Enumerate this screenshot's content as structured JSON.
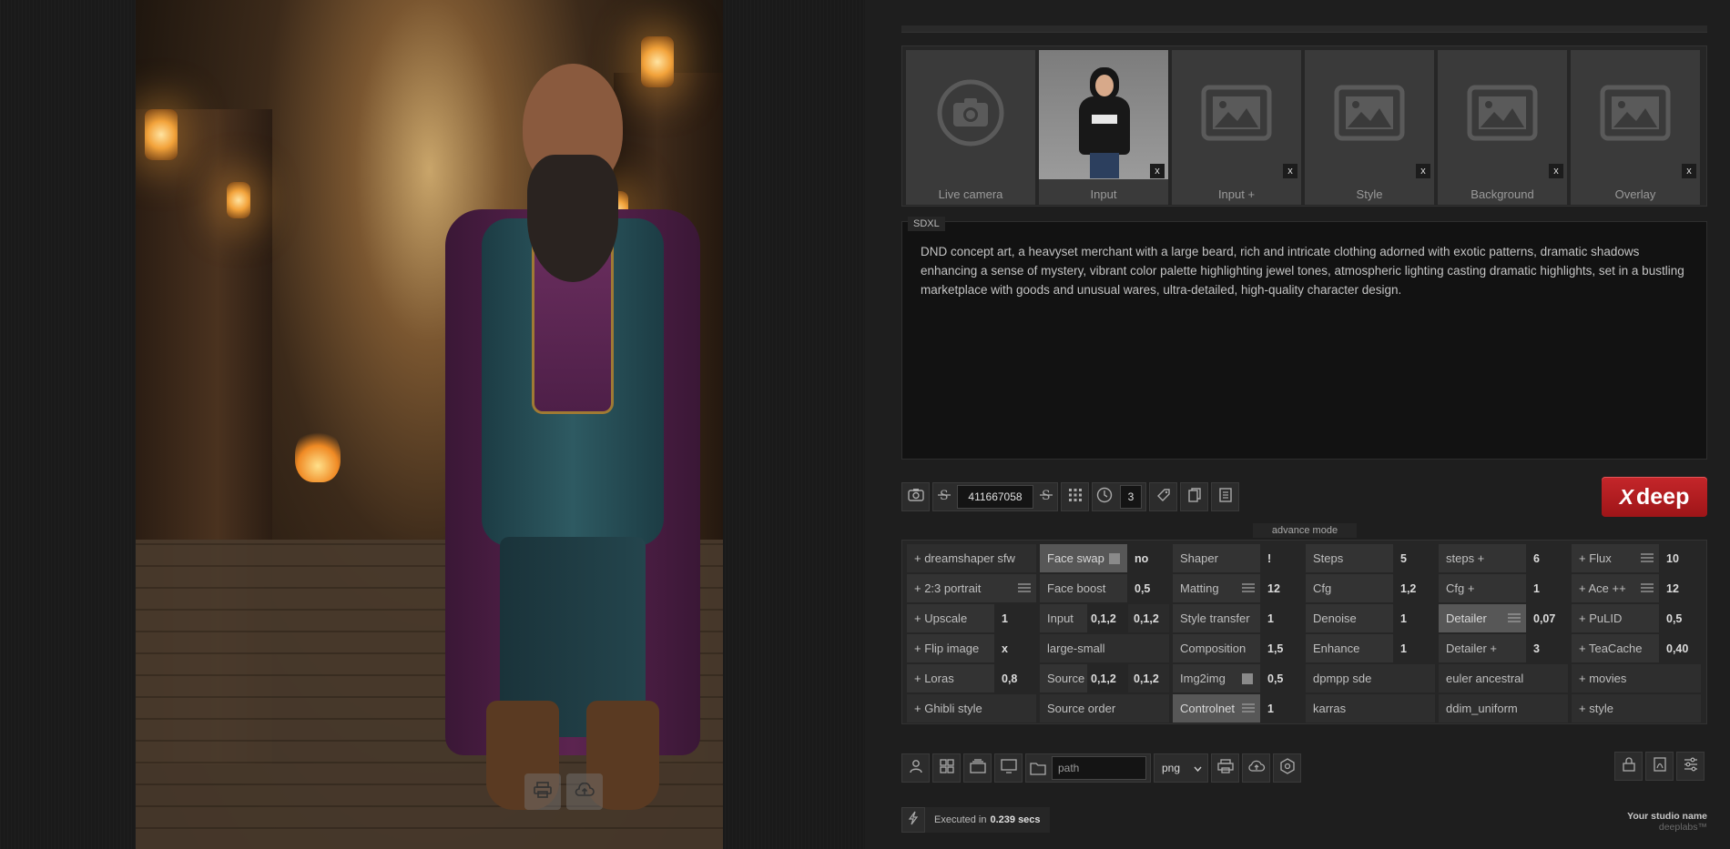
{
  "preview": {
    "tools": [
      {
        "icon": "printer-icon"
      },
      {
        "icon": "cloud-upload-icon"
      }
    ]
  },
  "slots": [
    {
      "label": "Live camera",
      "icon": "camera-icon",
      "has_close": false
    },
    {
      "label": "Input",
      "icon": "input-photo",
      "has_close": true
    },
    {
      "label": "Input +",
      "icon": "image-placeholder-icon",
      "has_close": true
    },
    {
      "label": "Style",
      "icon": "image-placeholder-icon",
      "has_close": true
    },
    {
      "label": "Background",
      "icon": "image-placeholder-icon",
      "has_close": true
    },
    {
      "label": "Overlay",
      "icon": "image-placeholder-icon",
      "has_close": true
    }
  ],
  "slot_close_label": "x",
  "prompt": {
    "model": "SDXL",
    "text": "DND concept art, a heavyset merchant with a large beard, rich and intricate clothing adorned with exotic patterns, dramatic shadows enhancing a sense of mystery, vibrant color palette highlighting jewel tones, atmospheric lighting casting dramatic highlights, set in a bustling marketplace with goods and unusual wares, ultra-detailed, high-quality character design."
  },
  "toolbar": {
    "seed": "411667058",
    "batch": "3"
  },
  "generate": {
    "label": "deep",
    "mark": "X",
    "color": "#b81d21"
  },
  "advance_label": "advance mode",
  "grid": {
    "columns": [
      [
        {
          "label": "+ dreamshaper sfw",
          "full": true
        },
        {
          "label": "+ 2:3 portrait",
          "menu": true
        },
        {
          "label": "+ Upscale",
          "value": "1"
        },
        {
          "label": "+ Flip image",
          "value": "x"
        },
        {
          "label": "+ Loras",
          "value": "0,8"
        },
        {
          "label": "+ Ghibli style",
          "full": true
        }
      ],
      [
        {
          "label": "Face swap",
          "highlight": true,
          "checkbox": true,
          "value": "no"
        },
        {
          "label": "Face boost",
          "value": "0,5"
        },
        {
          "label": "Input",
          "value": "0,1,2",
          "value2": "0,1,2"
        },
        {
          "label": "large-small",
          "full": true
        },
        {
          "label": "Source",
          "value": "0,1,2",
          "value2": "0,1,2"
        },
        {
          "label": "Source order",
          "full": true
        }
      ],
      [
        {
          "label": "Shaper",
          "value": "!"
        },
        {
          "label": "Matting",
          "menu": true,
          "value": "12"
        },
        {
          "label": "Style transfer",
          "value": "1"
        },
        {
          "label": "Composition",
          "value": "1,5"
        },
        {
          "label": "Img2img",
          "checkbox": true,
          "value": "0,5"
        },
        {
          "label": "Controlnet",
          "highlight": true,
          "menu": true,
          "value": "1"
        }
      ],
      [
        {
          "label": "Steps",
          "value": "5"
        },
        {
          "label": "Cfg",
          "value": "1,2"
        },
        {
          "label": "Denoise",
          "value": "1"
        },
        {
          "label": "Enhance",
          "value": "1"
        },
        {
          "label": "dpmpp sde",
          "full": true
        },
        {
          "label": "karras",
          "full": true
        }
      ],
      [
        {
          "label": "steps +",
          "value": "6"
        },
        {
          "label": "Cfg +",
          "value": "1"
        },
        {
          "label": "Detailer",
          "highlight": true,
          "menu": true,
          "value": "0,07"
        },
        {
          "label": "Detailer +",
          "value": "3"
        },
        {
          "label": "euler ancestral",
          "full": true
        },
        {
          "label": "ddim_uniform",
          "full": true
        }
      ],
      [
        {
          "label": "+ Flux",
          "menu": true,
          "value": "10"
        },
        {
          "label": "+ Ace ++",
          "menu": true,
          "value": "12"
        },
        {
          "label": "+ PuLID",
          "value": "0,5"
        },
        {
          "label": "+ TeaCache",
          "value": "0,40"
        },
        {
          "label": "+ movies",
          "full": true
        },
        {
          "label": "+ style",
          "full": true
        }
      ]
    ]
  },
  "bottom": {
    "path_placeholder": "path",
    "format": "png"
  },
  "status": {
    "prefix": "Executed in",
    "time": "0.239 secs"
  },
  "studio": {
    "name": "Your studio name",
    "brand": "deeplabs™"
  }
}
